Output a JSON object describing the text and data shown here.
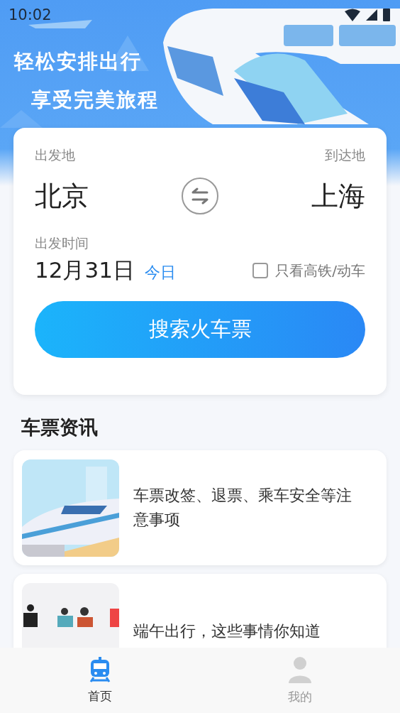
{
  "status_bar": {
    "time": "10:02"
  },
  "banner": {
    "kind": "picture",
    "slogans": [
      "轻松安排出行",
      "享受完美旅程"
    ]
  },
  "search_card": {
    "from_label": "出发地",
    "from": "北京",
    "to_label": "到达地",
    "to": "上海",
    "date_label": "出发时间",
    "date": "12月31日",
    "date_hint": "今日",
    "high_speed_only": {
      "label": "只看高铁/动车",
      "checked": false
    },
    "search_button": "搜索火车票"
  },
  "news": {
    "title": "车票资讯",
    "items": [
      {
        "title": "车票改签、退票、乘车安全等注意事项"
      },
      {
        "title": "端午出行，这些事情你知道"
      }
    ]
  },
  "bottom_nav": [
    {
      "label": "首页",
      "selected": true
    },
    {
      "label": "我的",
      "selected": false
    }
  ]
}
